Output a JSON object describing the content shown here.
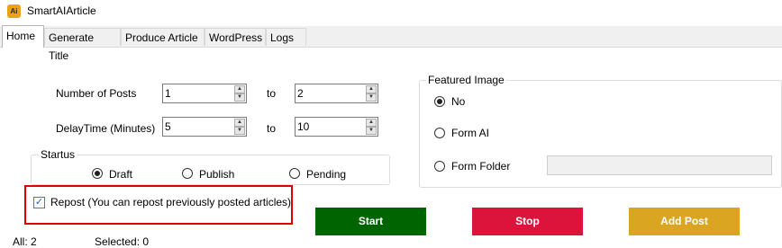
{
  "window": {
    "app_icon": "Ai",
    "title": "SmartAIArticle"
  },
  "tabs": [
    "Home",
    "Generate Title",
    "Produce Article",
    "WordPress",
    "Logs"
  ],
  "posts": {
    "label": "Number of Posts",
    "from": "1",
    "to_label": "to",
    "to": "2"
  },
  "delay": {
    "label": "DelayTime (Minutes)",
    "from": "5",
    "to_label": "to",
    "to": "10"
  },
  "status": {
    "title": "Startus",
    "options": [
      "Draft",
      "Publish",
      "Pending"
    ],
    "selected": "Draft"
  },
  "featured": {
    "title": "Featured Image",
    "options": [
      "No",
      "Form AI",
      "Form Folder"
    ],
    "selected": "No",
    "folder_path": ""
  },
  "repost": {
    "label": "Repost (You can repost previously posted articles)",
    "checked": true,
    "highlight_color": "#e00000"
  },
  "buttons": {
    "start": {
      "label": "Start",
      "color": "#006400"
    },
    "stop": {
      "label": "Stop",
      "color": "#dc143c"
    },
    "add": {
      "label": "Add Post",
      "color": "#daa520"
    }
  },
  "statusbar": {
    "all": "All: 2",
    "selected": "Selected: 0"
  }
}
